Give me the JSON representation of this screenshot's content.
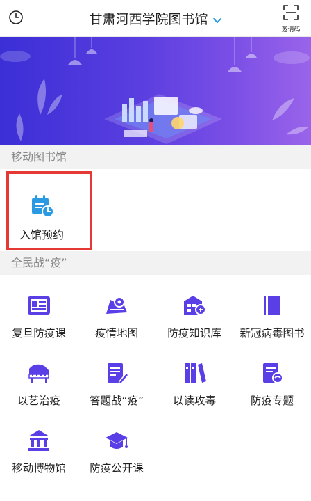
{
  "header": {
    "title": "甘肃河西学院图书馆",
    "invite_label": "邀请码"
  },
  "colors": {
    "accent": "#2a9be2",
    "icon_purple": "#5b3fe6",
    "highlight_red": "#e53935",
    "banner_start": "#3b2fd6",
    "banner_end": "#9a64ea"
  },
  "sections": {
    "mobile_library": "移动图书馆",
    "anti_epidemic": "全民战“疫”"
  },
  "mobile_library_items": [
    {
      "label": "入馆预约",
      "icon": "calendar-clock-icon"
    }
  ],
  "epidemic_items": [
    {
      "label": "复旦防疫课",
      "icon": "fudan-course-icon"
    },
    {
      "label": "疫情地图",
      "icon": "epidemic-map-icon"
    },
    {
      "label": "防疫知识库",
      "icon": "knowledge-base-icon"
    },
    {
      "label": "新冠病毒图书",
      "icon": "book-icon"
    },
    {
      "label": "以艺治疫",
      "icon": "piano-icon"
    },
    {
      "label": "答题战“疫”",
      "icon": "quiz-edit-icon"
    },
    {
      "label": "以读攻毒",
      "icon": "books-icon"
    },
    {
      "label": "防疫专题",
      "icon": "topic-doc-icon"
    },
    {
      "label": "移动博物馆",
      "icon": "museum-icon"
    },
    {
      "label": "防疫公开课",
      "icon": "graduation-cap-icon"
    }
  ]
}
